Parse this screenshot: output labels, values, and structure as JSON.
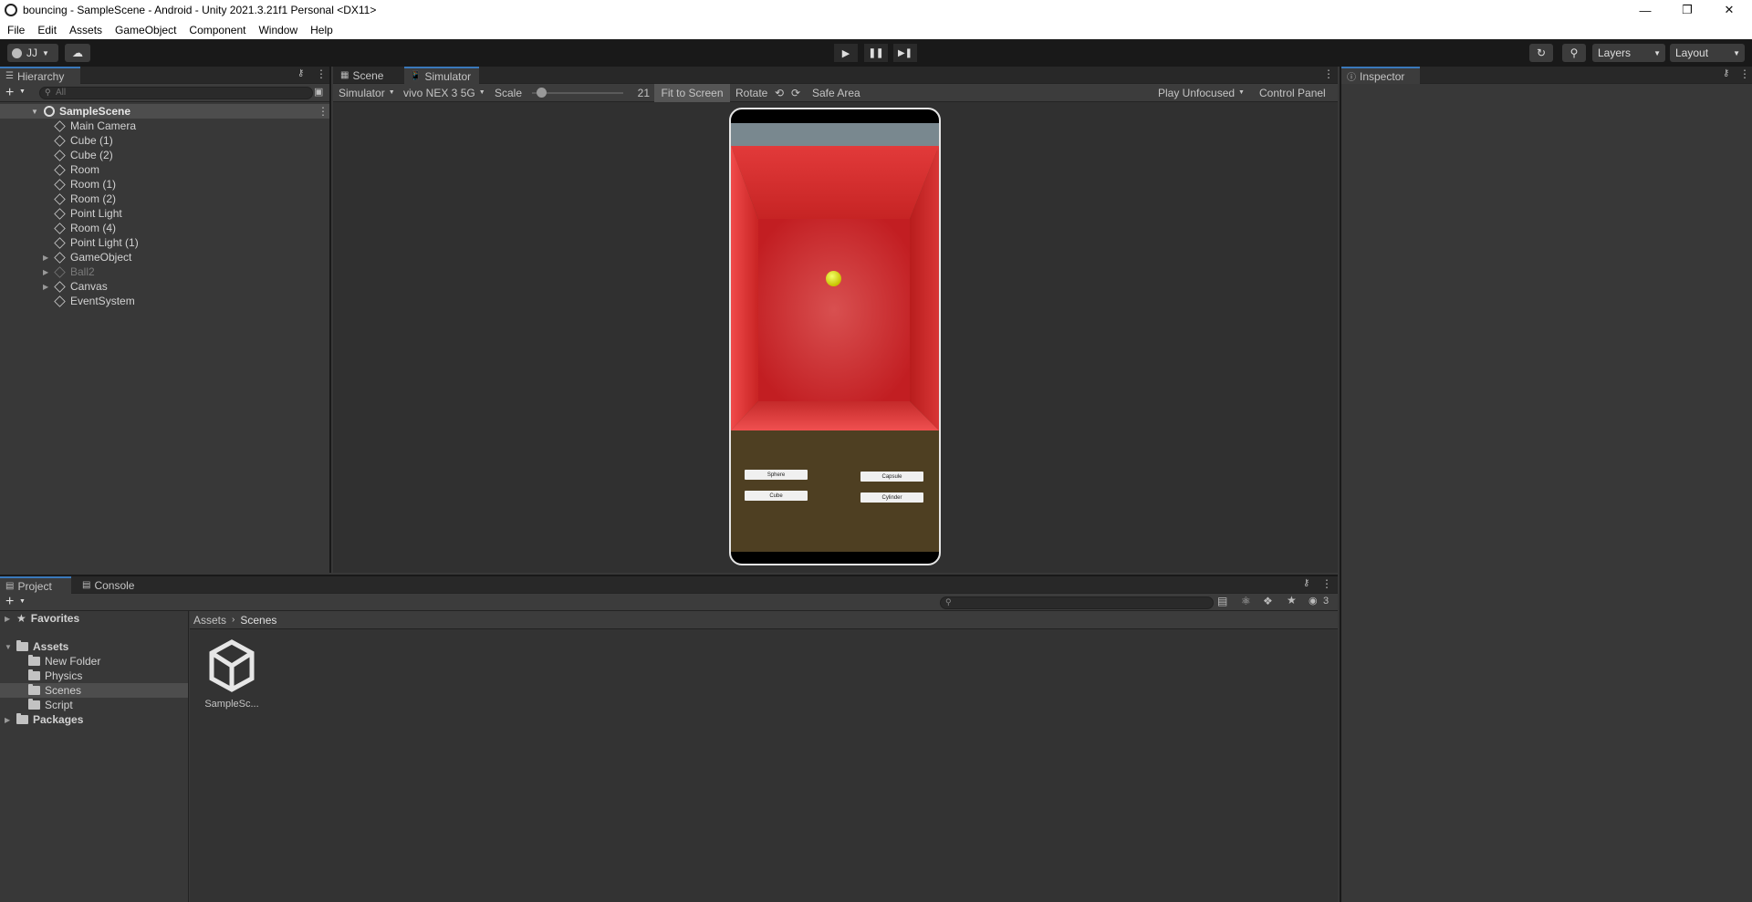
{
  "window": {
    "title": "bouncing - SampleScene - Android - Unity 2021.3.21f1 Personal <DX11>"
  },
  "menu": [
    "File",
    "Edit",
    "Assets",
    "GameObject",
    "Component",
    "Window",
    "Help"
  ],
  "toolbar": {
    "account": "JJ",
    "layers": "Layers",
    "layout": "Layout"
  },
  "hierarchy": {
    "tab": "Hierarchy",
    "search_placeholder": "All",
    "scene": "SampleScene",
    "items": [
      {
        "label": "Main Camera",
        "expandable": false,
        "dim": false
      },
      {
        "label": "Cube (1)",
        "expandable": false,
        "dim": false
      },
      {
        "label": "Cube (2)",
        "expandable": false,
        "dim": false
      },
      {
        "label": "Room",
        "expandable": false,
        "dim": false
      },
      {
        "label": "Room (1)",
        "expandable": false,
        "dim": false
      },
      {
        "label": "Room (2)",
        "expandable": false,
        "dim": false
      },
      {
        "label": "Point Light",
        "expandable": false,
        "dim": false
      },
      {
        "label": "Room (4)",
        "expandable": false,
        "dim": false
      },
      {
        "label": "Point Light (1)",
        "expandable": false,
        "dim": false
      },
      {
        "label": "GameObject",
        "expandable": true,
        "dim": false
      },
      {
        "label": "Ball2",
        "expandable": true,
        "dim": true
      },
      {
        "label": "Canvas",
        "expandable": true,
        "dim": false
      },
      {
        "label": "EventSystem",
        "expandable": false,
        "dim": false
      }
    ]
  },
  "center": {
    "tabs": [
      "Scene",
      "Simulator"
    ],
    "sim_toolbar": {
      "mode": "Simulator",
      "device": "vivo NEX 3 5G",
      "scale_label": "Scale",
      "scale_value": "21",
      "scale_fraction": 0.1,
      "fit": "Fit to Screen",
      "rotate": "Rotate",
      "safe_area": "Safe Area",
      "play_mode": "Play Unfocused",
      "control_panel": "Control Panel"
    },
    "game_buttons": [
      "Sphere",
      "Capsule",
      "Cube",
      "Cylinder"
    ]
  },
  "inspector": {
    "tab": "Inspector"
  },
  "project": {
    "tabs": [
      "Project",
      "Console"
    ],
    "hidden_count": "3",
    "tree": [
      {
        "label": "Favorites",
        "level": 0,
        "kind": "star",
        "bold": true
      },
      {
        "label": "Assets",
        "level": 0,
        "kind": "folder-open",
        "bold": true
      },
      {
        "label": "New Folder",
        "level": 1,
        "kind": "folder",
        "bold": false
      },
      {
        "label": "Physics",
        "level": 1,
        "kind": "folder",
        "bold": false
      },
      {
        "label": "Scenes",
        "level": 1,
        "kind": "folder",
        "bold": false,
        "selected": true
      },
      {
        "label": "Script",
        "level": 1,
        "kind": "folder",
        "bold": false
      },
      {
        "label": "Packages",
        "level": 0,
        "kind": "folder",
        "bold": true
      }
    ],
    "breadcrumb": [
      "Assets",
      "Scenes"
    ],
    "assets": [
      {
        "label": "SampleSc..."
      }
    ]
  },
  "colors": {
    "accent": "#3a79bb",
    "panel": "#383838",
    "toolbar": "#191919"
  }
}
